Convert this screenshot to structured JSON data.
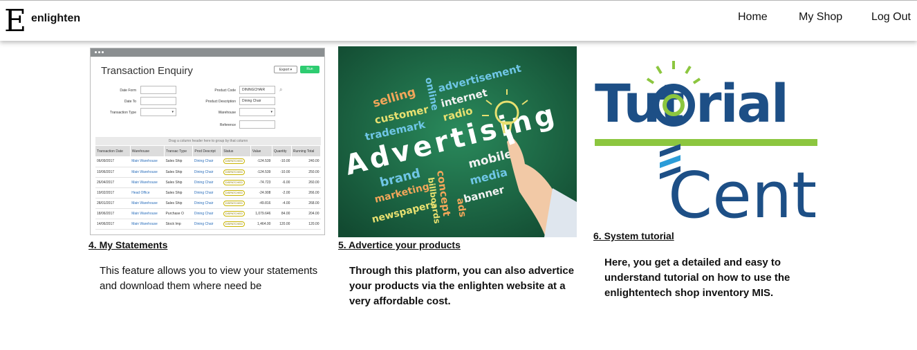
{
  "nav": {
    "logo_letter": "E",
    "brand": "enlighten",
    "links": [
      "Home",
      "My Shop",
      "Log Out"
    ]
  },
  "cards": [
    {
      "title": "4. My Statements",
      "desc_lines": [
        "This feature allows you to view your statements",
        "and download them where need be"
      ]
    },
    {
      "title": "5. Advertice your products",
      "desc_lines": [
        "Through this platform, you can also advertice",
        "your products via the enlighten website at a",
        "very affordable cost."
      ]
    },
    {
      "title": "6. System tutorial",
      "desc_lines": [
        "Here, you get a detailed and easy to",
        "understand tutorial on how to use the",
        "enlightentech shop inventory MIS."
      ]
    }
  ],
  "statement_image": {
    "title": "Transaction Enquiry",
    "export_label": "Export",
    "run_label": "Run",
    "fields_left": [
      "Date Form",
      "Date To",
      "Transaction Type"
    ],
    "fields_right": [
      "Product Code",
      "Product Description",
      "Warehouse",
      "Reference"
    ],
    "product_code_value": "DININGCHAIR",
    "product_desc_value": "Dining Chair",
    "group_hint": "Drag a column header here to group by that column",
    "columns": [
      "Transaction Date",
      "Warehouse",
      "Transac Type",
      "Prod Descript",
      "Status",
      "Value",
      "Quantity",
      "Running Total"
    ],
    "rows": [
      [
        "06/09/2017",
        "Main Warehouse",
        "Sales Ship",
        "Dining Chair",
        "DISPATCHED",
        "-124.539",
        "-10.00",
        "240.00"
      ],
      [
        "10/06/2017",
        "Main Warehouse",
        "Sales Ship",
        "Dining Chair",
        "DISPATCHED",
        "-124.539",
        "-10.00",
        "250.00"
      ],
      [
        "26/04/2017",
        "Main Warehouse",
        "Sales Ship",
        "Dining Chair",
        "DISPATCHED",
        "-74.723",
        "-6.00",
        "260.00"
      ],
      [
        "19/02/2017",
        "Head Office",
        "Sales Ship",
        "Dining Chair",
        "DISPATCHED",
        "-24.908",
        "-2.00",
        "266.00"
      ],
      [
        "28/01/2017",
        "Main Warehouse",
        "Sales Ship",
        "Dining Chair",
        "DISPATCHED",
        "-49.816",
        "-4.00",
        "268.00"
      ],
      [
        "18/06/2017",
        "Main Warehouse",
        "Purchase O",
        "Dining Chair",
        "DISPATCHED",
        "1,079.646",
        "84.00",
        "204.00"
      ],
      [
        "14/06/2017",
        "Main Warehouse",
        "Stock Imp",
        "Dining Chair",
        "DISPATCHED",
        "1,464.00",
        "120.00",
        "120.00"
      ]
    ]
  },
  "advert_image": {
    "headline": "Advertising",
    "words": [
      "selling",
      "customer",
      "trademark",
      "online",
      "advertisement",
      "internet",
      "radio",
      "brand",
      "marketing",
      "newspapers",
      "billboards",
      "concept",
      "mobile",
      "media",
      "banner",
      "ads"
    ]
  },
  "tutorial_image": {
    "line1": "Tut",
    "line1b": "rial",
    "line2": "Center"
  },
  "colors": {
    "nav_bg": "#ffffff",
    "advert_bg": "#1e6b48",
    "tutorial_blue": "#1d4f86",
    "tutorial_green": "#8cc63f"
  }
}
